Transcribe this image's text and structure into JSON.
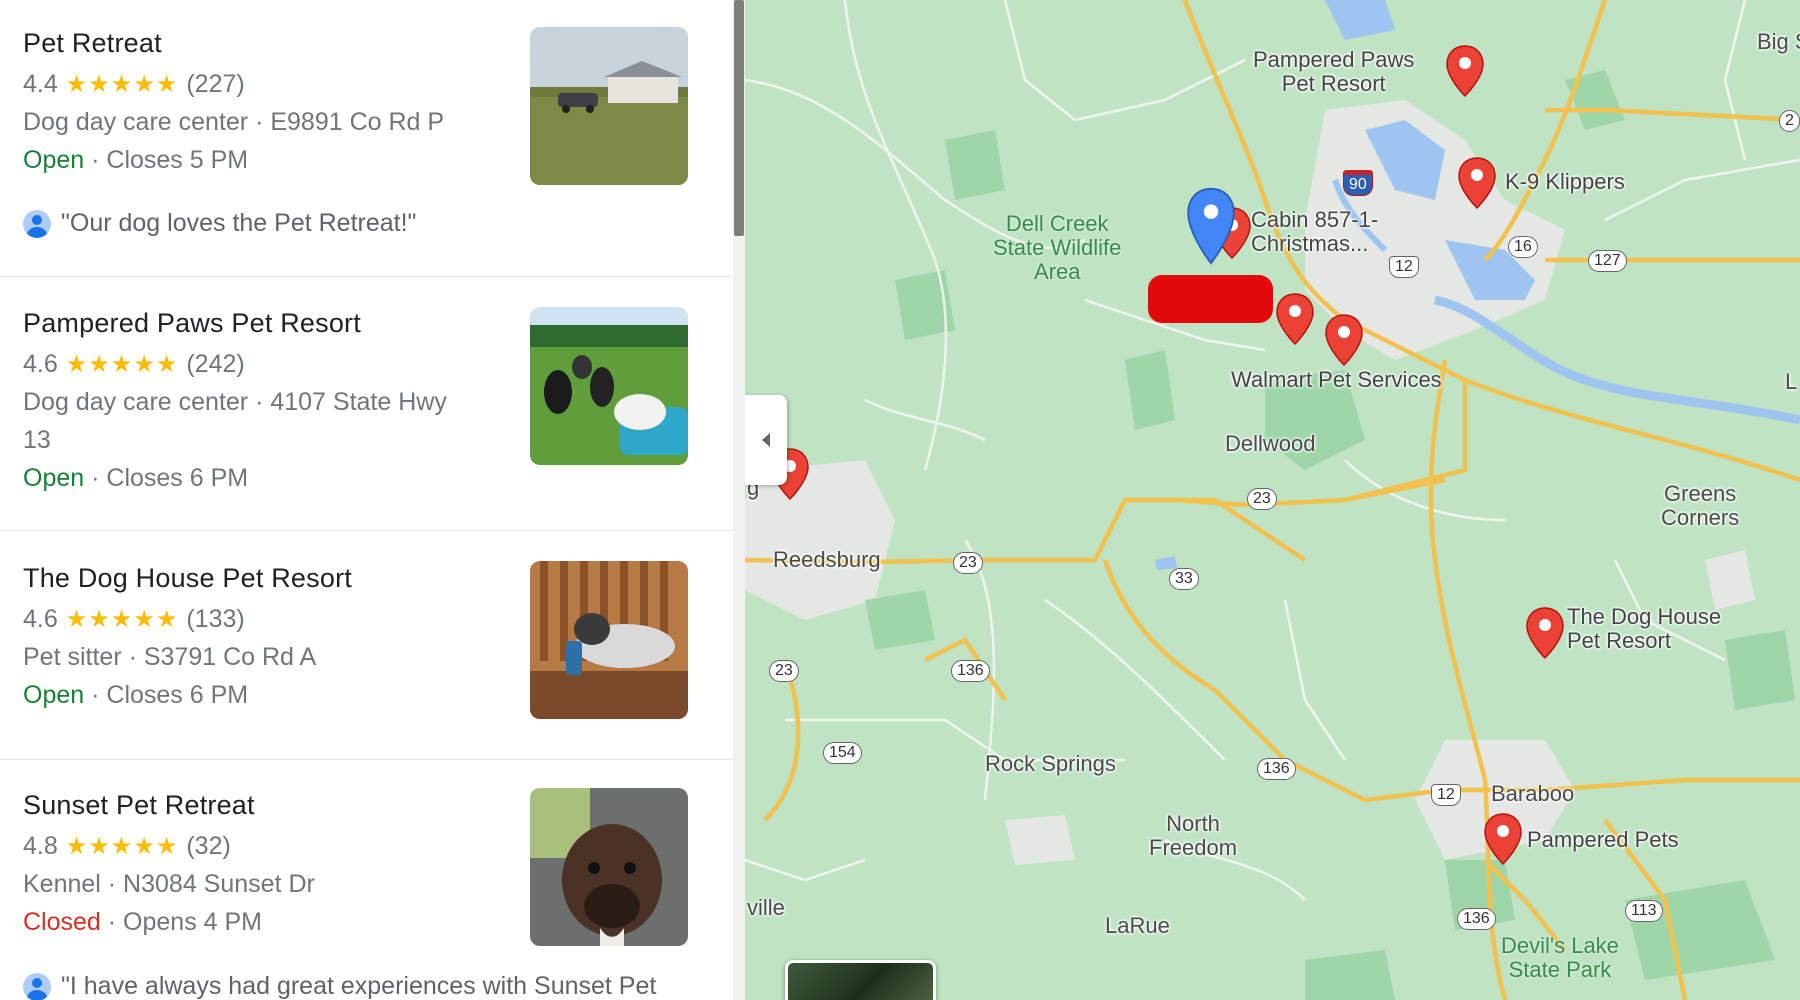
{
  "results": [
    {
      "name": "Pet Retreat",
      "rating": "4.4",
      "stars": "★★★★★",
      "reviews": "(227)",
      "category_address": "Dog day care center · E9891 Co Rd P",
      "status": "Open",
      "hours": " · Closes 5 PM",
      "quote": "\"Our dog loves the Pet Retreat!\""
    },
    {
      "name": "Pampered Paws Pet Resort",
      "rating": "4.6",
      "stars": "★★★★★",
      "reviews": "(242)",
      "category_address": "Dog day care center · 4107 State Hwy",
      "category_address_2": "13",
      "status": "Open",
      "hours": " · Closes 6 PM"
    },
    {
      "name": "The Dog House Pet Resort",
      "rating": "4.6",
      "stars": "★★★★★",
      "reviews": "(133)",
      "category_address": "Pet sitter · S3791 Co Rd A",
      "status": "Open",
      "hours": " · Closes 6 PM"
    },
    {
      "name": "Sunset Pet Retreat",
      "rating": "4.8",
      "stars": "★★★★★",
      "reviews": "(32)",
      "category_address": "Kennel · N3084 Sunset Dr",
      "status": "Closed",
      "hours": " · Opens 4 PM",
      "quote": "\"I have always had great experiences with Sunset Pet"
    }
  ],
  "map": {
    "places": {
      "pampered_paws": "Pampered Paws\nPet Resort",
      "k9": "K-9 Klippers",
      "cabin": "Cabin 857-1-\nChristmas...",
      "walmart": "Walmart Pet Services",
      "dog_house": "The Dog House\nPet Resort",
      "pampered_pets": "Pampered Pets"
    },
    "towns": {
      "big": "Big S",
      "dell_creek": "Dell Creek\nState Wildlife\nArea",
      "dellwood": "Dellwood",
      "reedsburg": "Reedsburg",
      "greens_corners": "Greens\nCorners",
      "rock_springs": "Rock Springs",
      "north_freedom": "North\nFreedom",
      "baraboo": "Baraboo",
      "larue": "LaRue",
      "devils_lake": "Devil's Lake\nState Park",
      "ville": "ville",
      "edge_g": "g",
      "edge_l": "L"
    },
    "shields": {
      "i90": "90",
      "r16": "16",
      "r127": "127",
      "us12a": "12",
      "us12b": "12",
      "r23a": "23",
      "r23b": "23",
      "r23c": "23",
      "r33": "33",
      "r136a": "136",
      "r136b": "136",
      "r136c": "136",
      "r154": "154",
      "r113": "113",
      "r2x": "2"
    },
    "colors": {
      "land": "#bfe3c3",
      "forest": "#8fce9c",
      "urban": "#e8eaed",
      "water": "#9ec5f0",
      "highway": "#f7c949",
      "road": "#ffffff",
      "pin_red": "#ea4335",
      "pin_blue": "#4285f4"
    }
  }
}
